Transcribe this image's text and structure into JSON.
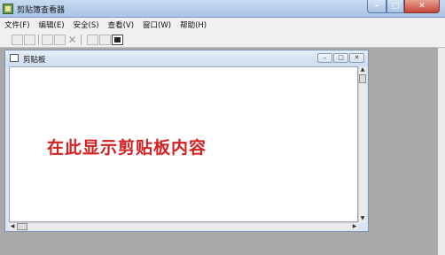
{
  "window": {
    "title": "剪贴簿查看器",
    "buttons": {
      "minimize": "–",
      "maximize": "□",
      "close": "✕"
    }
  },
  "menu": [
    "文件(F)",
    "编辑(E)",
    "安全(S)",
    "查看(V)",
    "窗口(W)",
    "帮助(H)"
  ],
  "child_window": {
    "title": "剪贴板",
    "buttons": {
      "minimize": "–",
      "maximize": "□",
      "close": "✕"
    }
  },
  "content": {
    "placeholder_text": "在此显示剪贴板内容"
  },
  "scrollbars": {
    "up": "▲",
    "down": "▼",
    "left": "◀",
    "right": "▶"
  }
}
